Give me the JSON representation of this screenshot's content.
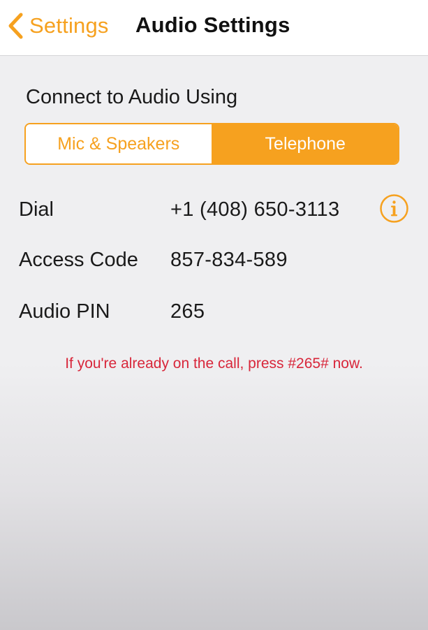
{
  "nav": {
    "back_label": "Settings",
    "title": "Audio Settings"
  },
  "connect": {
    "heading": "Connect to Audio Using",
    "options": [
      "Mic & Speakers",
      "Telephone"
    ],
    "selected": "Telephone"
  },
  "details": {
    "dial_label": "Dial",
    "dial_value": "+1 (408) 650-3113",
    "access_code_label": "Access Code",
    "access_code_value": "857-834-589",
    "audio_pin_label": "Audio PIN",
    "audio_pin_value": "265"
  },
  "notice": "If you're already on the call, press #265# now.",
  "colors": {
    "accent": "#f6a11f",
    "notice": "#d8263a"
  },
  "icons": {
    "back": "chevron-left-icon",
    "info": "info-circle-icon"
  }
}
